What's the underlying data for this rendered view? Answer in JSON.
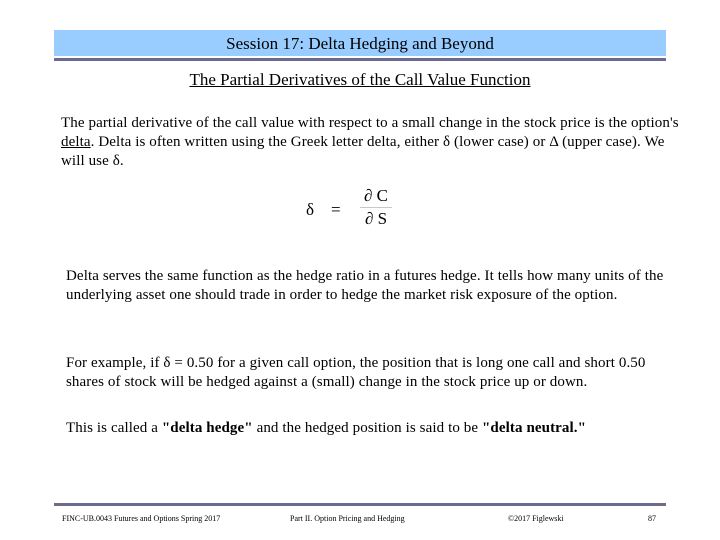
{
  "header": {
    "title": "Session 17: Delta Hedging and Beyond",
    "band_color": "#99ccff",
    "rule_color": "#6b6b8f"
  },
  "subtitle": "The Partial Derivatives of the Call Value Function",
  "paragraph1": {
    "text_a": "The partial derivative of the call value with respect to a small change in the stock price is the option's ",
    "link_word": "delta",
    "text_b": ".  Delta is often written using the Greek letter delta, either δ (lower case) or Δ (upper case).  We will use δ."
  },
  "formula": {
    "lhs": "δ",
    "eq": "=",
    "numerator": "∂ C",
    "denominator": "∂ S"
  },
  "paragraph2": "Delta serves the same function as the hedge ratio in a futures hedge.  It tells how many units of the underlying asset one should trade in order to hedge the market risk exposure of the option.",
  "paragraph3": "For example, if  δ = 0.50  for a given call option, the position that is long one call and short 0.50 shares of stock will be hedged against a (small) change in the stock price up or down.",
  "paragraph4": {
    "text_a": "This is called a ",
    "bold_a": "\"delta hedge\"",
    "text_b": " and the hedged position is said to be ",
    "bold_b": "\"delta neutral.\""
  },
  "footer": {
    "course": "FINC-UB.0043  Futures and Options  Spring 2017",
    "part": "Part II. Option Pricing and Hedging",
    "copyright": "©2017 Figlewski",
    "page": "87"
  }
}
